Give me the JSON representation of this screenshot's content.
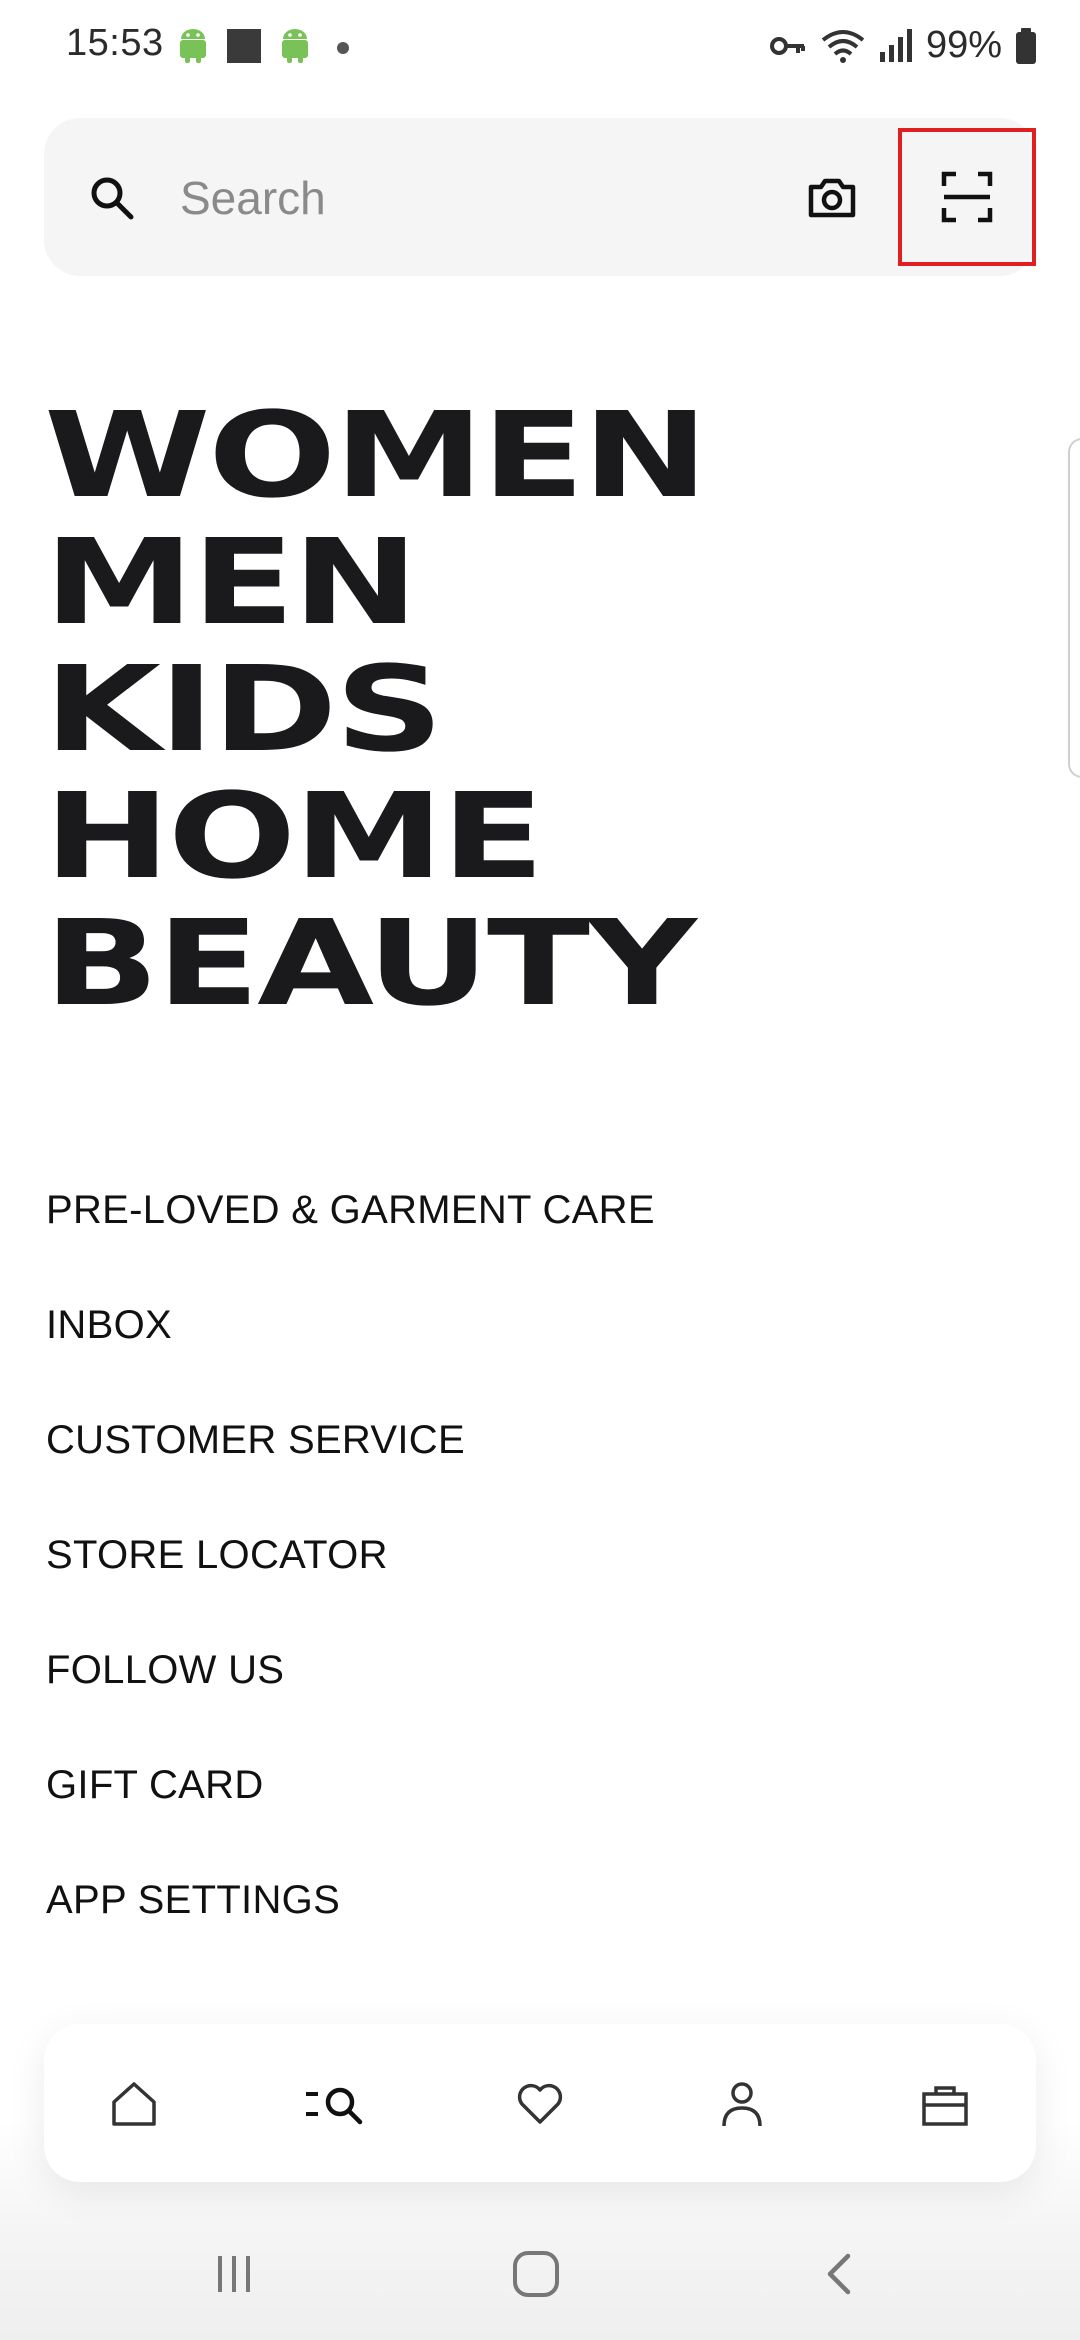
{
  "status_bar": {
    "time": "15:53",
    "battery_percent": "99%",
    "left_icons": [
      "android-icon",
      "square-icon",
      "android-icon",
      "dot-icon"
    ],
    "right_icons": [
      "key-icon",
      "wifi-icon",
      "signal-icon",
      "battery-icon"
    ]
  },
  "search": {
    "placeholder": "Search",
    "value": "",
    "icons": [
      "search-icon",
      "camera-icon",
      "scan-icon"
    ]
  },
  "categories": [
    "WOMEN",
    "MEN",
    "KIDS",
    "HOME",
    "BEAUTY"
  ],
  "menu": [
    "PRE-LOVED & GARMENT CARE",
    "INBOX",
    "CUSTOMER SERVICE",
    "STORE LOCATOR",
    "FOLLOW US",
    "GIFT CARD",
    "APP SETTINGS"
  ],
  "bottom_nav": [
    "home-icon",
    "search-menu-icon",
    "heart-icon",
    "person-icon",
    "shopping-bag-icon"
  ],
  "system_nav": [
    "recent-apps-icon",
    "home-circle-icon",
    "back-icon"
  ],
  "colors": {
    "text": "#1a1a1d",
    "search_bg": "#f5f5f5",
    "highlight": "#e02020",
    "android_green": "#78c257"
  }
}
